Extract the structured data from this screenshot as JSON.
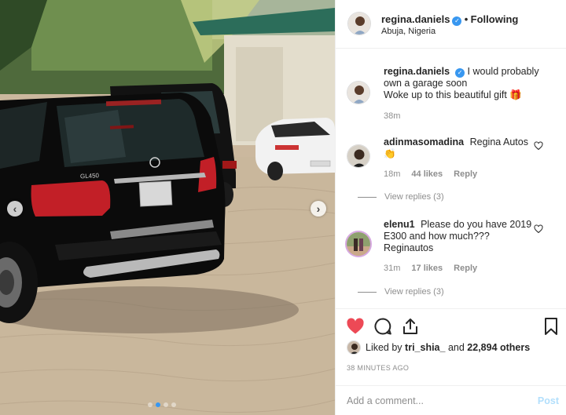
{
  "header": {
    "username": "regina.daniels",
    "separator": "•",
    "follow_label": "Following",
    "location": "Abuja, Nigeria"
  },
  "caption": {
    "username": "regina.daniels",
    "text_line1": "I would probably own a garage soon",
    "text_line2": "Woke up to this beautiful gift 🎁",
    "time": "38m"
  },
  "comments": [
    {
      "username": "adinmasomadina",
      "text": "Regina Autos",
      "emoji": "👏",
      "time": "18m",
      "likes": "44 likes",
      "reply_label": "Reply",
      "view_replies": "View replies (3)"
    },
    {
      "username": "elenu1",
      "text": "Please do you have 2019 E300 and how much??? Reginautos",
      "time": "31m",
      "likes": "17 likes",
      "reply_label": "Reply",
      "view_replies": "View replies (3)"
    }
  ],
  "likes": {
    "prefix": "Liked by",
    "user": "tri_shia_",
    "conj": "and",
    "others": "22,894 others"
  },
  "time_ago": "38 MINUTES AGO",
  "comment_box": {
    "placeholder": "Add a comment...",
    "post_label": "Post"
  },
  "photo": {
    "plate_text": "GL450",
    "carousel_total": 4,
    "carousel_active": 1
  },
  "colors": {
    "accent": "#3897f0",
    "like_red": "#ed4956",
    "muted": "#8e8e8e",
    "post_disabled": "#b2dffc"
  }
}
